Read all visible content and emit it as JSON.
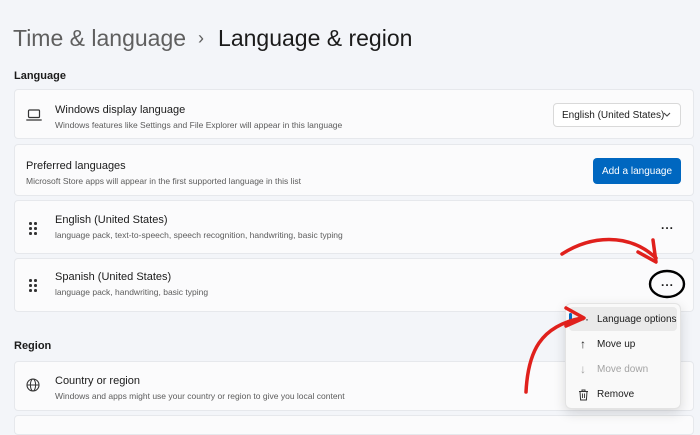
{
  "breadcrumb": {
    "parent": "Time & language",
    "separator": "›",
    "current": "Language & region"
  },
  "sections": {
    "language": "Language",
    "region": "Region"
  },
  "display_language": {
    "title": "Windows display language",
    "subtitle": "Windows features like Settings and File Explorer will appear in this language",
    "value": "English (United States)",
    "icon": "laptop-icon"
  },
  "preferred": {
    "title": "Preferred languages",
    "subtitle": "Microsoft Store apps will appear in the first supported language in this list",
    "button": "Add a language"
  },
  "languages": [
    {
      "name": "English (United States)",
      "features": "language pack, text-to-speech, speech recognition, handwriting, basic typing",
      "more": "..."
    },
    {
      "name": "Spanish (United States)",
      "features": "language pack, handwriting, basic typing",
      "more": "..."
    }
  ],
  "context_menu": [
    {
      "label": "Language options",
      "icon": "ellipsis-icon",
      "glyph": "···",
      "state": "highlighted"
    },
    {
      "label": "Move up",
      "icon": "arrow-up-icon",
      "glyph": "↑",
      "state": "normal"
    },
    {
      "label": "Move down",
      "icon": "arrow-down-icon",
      "glyph": "↓",
      "state": "disabled"
    },
    {
      "label": "Remove",
      "icon": "trash-icon",
      "glyph": "",
      "state": "normal"
    }
  ],
  "region": {
    "title": "Country or region",
    "subtitle": "Windows and apps might use your country or region to give you local content",
    "icon": "globe-icon"
  },
  "annotation_color": "#e0201c",
  "accent_color": "#0067c0"
}
